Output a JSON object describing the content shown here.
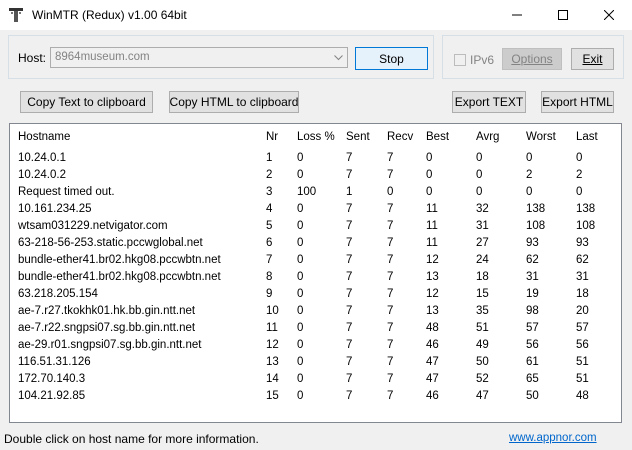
{
  "window": {
    "title": "WinMTR (Redux) v1.00 64bit"
  },
  "host": {
    "label": "Host:",
    "value": "8964museum.com"
  },
  "buttons": {
    "stop": "Stop",
    "ipv6": "IPv6",
    "ipv6_checked": false,
    "options": "Options",
    "exit": "Exit",
    "copy_text": "Copy Text to clipboard",
    "copy_html": "Copy HTML to clipboard",
    "export_text": "Export TEXT",
    "export_html": "Export HTML"
  },
  "table": {
    "columns": [
      "Hostname",
      "Nr",
      "Loss %",
      "Sent",
      "Recv",
      "Best",
      "Avrg",
      "Worst",
      "Last"
    ],
    "rows": [
      [
        "10.24.0.1",
        "1",
        "0",
        "7",
        "7",
        "0",
        "0",
        "0",
        "0"
      ],
      [
        "10.24.0.2",
        "2",
        "0",
        "7",
        "7",
        "0",
        "0",
        "2",
        "2"
      ],
      [
        "Request timed out.",
        "3",
        "100",
        "1",
        "0",
        "0",
        "0",
        "0",
        "0"
      ],
      [
        "10.161.234.25",
        "4",
        "0",
        "7",
        "7",
        "11",
        "32",
        "138",
        "138"
      ],
      [
        "wtsam031229.netvigator.com",
        "5",
        "0",
        "7",
        "7",
        "11",
        "31",
        "108",
        "108"
      ],
      [
        "63-218-56-253.static.pccwglobal.net",
        "6",
        "0",
        "7",
        "7",
        "11",
        "27",
        "93",
        "93"
      ],
      [
        "bundle-ether41.br02.hkg08.pccwbtn.net",
        "7",
        "0",
        "7",
        "7",
        "12",
        "24",
        "62",
        "62"
      ],
      [
        "bundle-ether41.br02.hkg08.pccwbtn.net",
        "8",
        "0",
        "7",
        "7",
        "13",
        "18",
        "31",
        "31"
      ],
      [
        "63.218.205.154",
        "9",
        "0",
        "7",
        "7",
        "12",
        "15",
        "19",
        "18"
      ],
      [
        "ae-7.r27.tkokhk01.hk.bb.gin.ntt.net",
        "10",
        "0",
        "7",
        "7",
        "13",
        "35",
        "98",
        "20"
      ],
      [
        "ae-7.r22.sngpsi07.sg.bb.gin.ntt.net",
        "11",
        "0",
        "7",
        "7",
        "48",
        "51",
        "57",
        "57"
      ],
      [
        "ae-29.r01.sngpsi07.sg.bb.gin.ntt.net",
        "12",
        "0",
        "7",
        "7",
        "46",
        "49",
        "56",
        "56"
      ],
      [
        "116.51.31.126",
        "13",
        "0",
        "7",
        "7",
        "47",
        "50",
        "61",
        "51"
      ],
      [
        "172.70.140.3",
        "14",
        "0",
        "7",
        "7",
        "47",
        "52",
        "65",
        "51"
      ],
      [
        "104.21.92.85",
        "15",
        "0",
        "7",
        "7",
        "46",
        "47",
        "50",
        "48"
      ]
    ]
  },
  "status": {
    "message": "Double click on host name for more information.",
    "link": "www.appnor.com"
  },
  "icons": {
    "app": "winmtr-app-icon",
    "minimize": "minimize-icon",
    "maximize": "maximize-icon",
    "close": "close-icon",
    "combo": "chevron-down-icon"
  },
  "colors": {
    "accent_border": "#0078d7",
    "link": "#0066cc",
    "disabled_text": "#838383"
  }
}
